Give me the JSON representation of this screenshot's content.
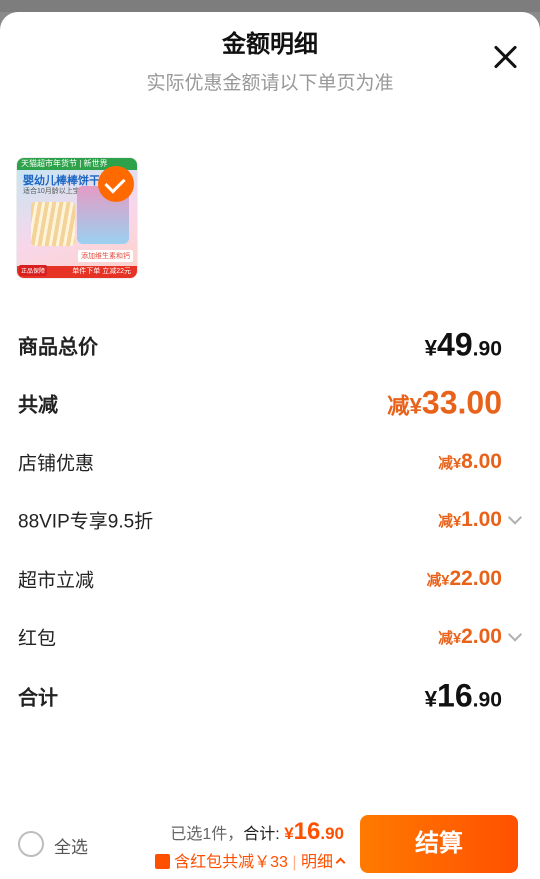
{
  "header": {
    "title": "金额明细",
    "subtitle": "实际优惠金额请以下单页为准"
  },
  "product": {
    "thumb_top": "天猫超市年货节 | 新世界",
    "thumb_name": "婴幼儿棒棒饼干",
    "thumb_sub": "适合10月龄以上宝宝",
    "thumb_tag": "添加维生素和钙",
    "thumb_bottom": "单件下单 立减22元",
    "thumb_badge": "正品保障"
  },
  "rows": [
    {
      "label": "商品总价",
      "prefix": "",
      "symbol": "¥",
      "int": "49",
      "dec": ".90"
    },
    {
      "label": "共减",
      "prefix": "减",
      "symbol": "¥",
      "int": "33",
      "dec": ".00"
    },
    {
      "label": "店铺优惠",
      "prefix": "减",
      "symbol": "¥",
      "int": "8",
      "dec": ".00"
    },
    {
      "label": "88VIP专享9.5折",
      "prefix": "减",
      "symbol": "¥",
      "int": "1",
      "dec": ".00"
    },
    {
      "label": "超市立减",
      "prefix": "减",
      "symbol": "¥",
      "int": "22",
      "dec": ".00"
    },
    {
      "label": "红包",
      "prefix": "减",
      "symbol": "¥",
      "int": "2",
      "dec": ".00"
    },
    {
      "label": "合计",
      "prefix": "",
      "symbol": "¥",
      "int": "16",
      "dec": ".90"
    }
  ],
  "footer": {
    "select_all": "全选",
    "selected": "已选1件，",
    "total_label": "合计:",
    "total_symbol": "¥",
    "total_int": "16",
    "total_dec": ".90",
    "red_packet": "含红包共减￥33",
    "divider": "|",
    "detail": "明细",
    "checkout": "结算"
  },
  "colors": {
    "accent": "#ff5000",
    "discount": "#e8621a",
    "text": "#111111"
  }
}
